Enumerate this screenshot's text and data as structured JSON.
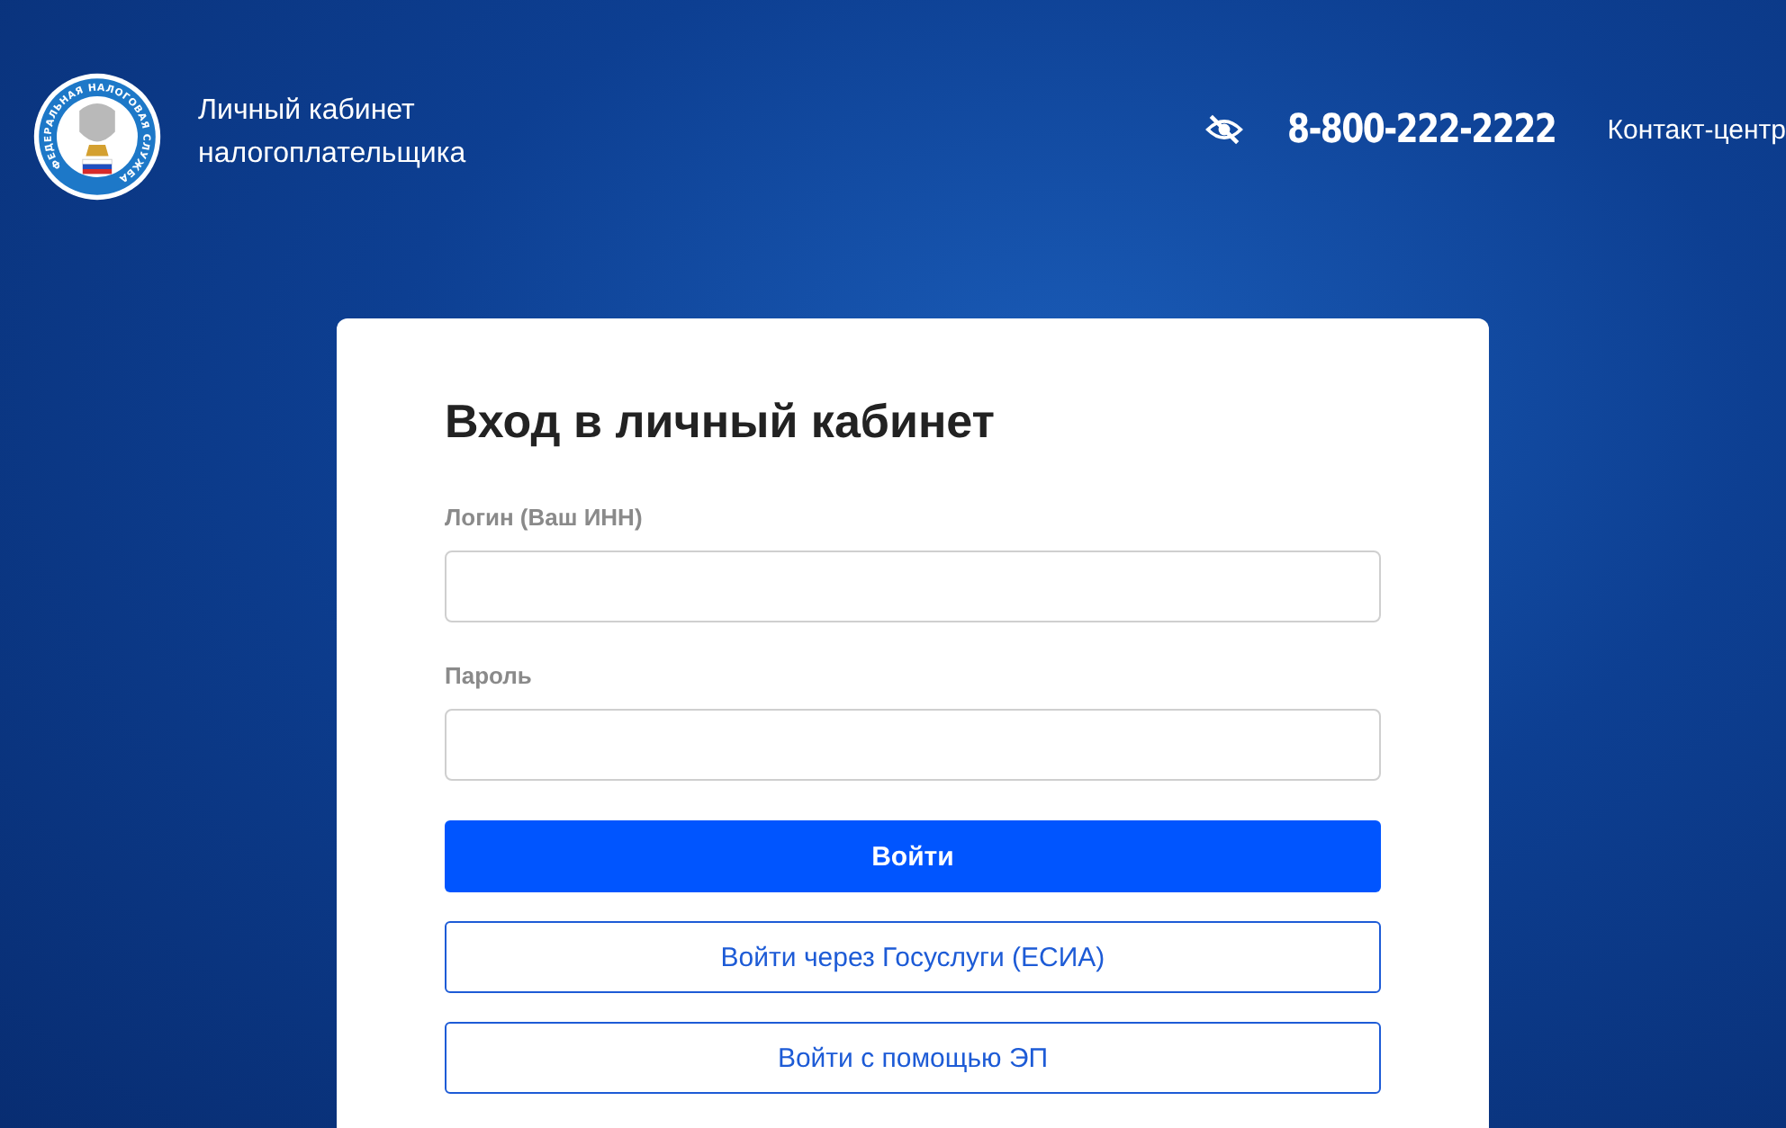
{
  "header": {
    "logo_text": "ФЕДЕРАЛЬНАЯ НАЛОГОВАЯ СЛУЖБА",
    "title_line1": "Личный кабинет",
    "title_line2": "налогоплательщика",
    "phone": "8-800-222-2222",
    "contact_label": "Контакт-центр"
  },
  "login_form": {
    "title": "Вход в личный кабинет",
    "fields": [
      {
        "label": "Логин (Ваш ИНН)"
      },
      {
        "label": "Пароль"
      }
    ],
    "buttons": [
      {
        "label": "Войти",
        "kind": "primary"
      },
      {
        "label": "Войти через Госуслуги (ЕСИА)",
        "kind": "outline"
      },
      {
        "label": "Войти с помощью ЭП",
        "kind": "outline"
      }
    ]
  }
}
